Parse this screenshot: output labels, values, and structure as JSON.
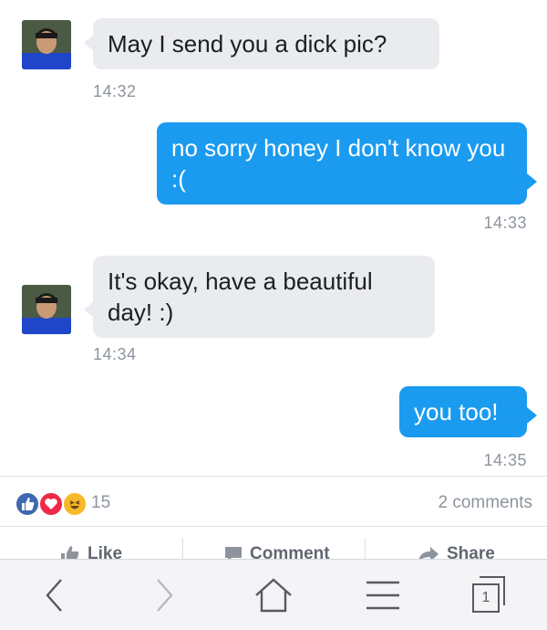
{
  "messages": [
    {
      "sender": "them",
      "text": "May I send you a dick pic?",
      "time": "14:32"
    },
    {
      "sender": "me",
      "text": "no sorry honey I don't know you :(",
      "time": "14:33"
    },
    {
      "sender": "them",
      "text": "It's okay, have a beautiful day! :)",
      "time": "14:34"
    },
    {
      "sender": "me",
      "text": "you too!",
      "time": "14:35"
    }
  ],
  "reactions": {
    "icons": [
      "like-icon",
      "love-icon",
      "haha-icon"
    ],
    "count": "15"
  },
  "comments": {
    "label": "2 comments"
  },
  "actions": {
    "like": "Like",
    "comment": "Comment",
    "share": "Share"
  },
  "toolbar": {
    "tabs_count": "1"
  },
  "colors": {
    "outgoing_bubble": "#1a9bf0",
    "incoming_bubble": "#e9ebee",
    "like_blue": "#4267b2",
    "love_red": "#f0284a",
    "haha_yellow": "#f7b928"
  }
}
